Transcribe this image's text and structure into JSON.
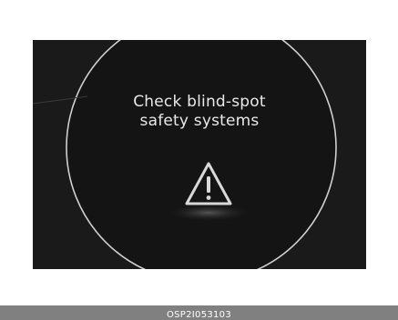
{
  "display": {
    "message_lines": [
      "Check blind-spot",
      "safety systems"
    ],
    "icon": "warning-triangle-icon",
    "background_color": "#1a1a1a",
    "text_color": "#e8e8e8"
  },
  "caption": {
    "code": "OSP2I053103",
    "bar_color": "#808080"
  }
}
